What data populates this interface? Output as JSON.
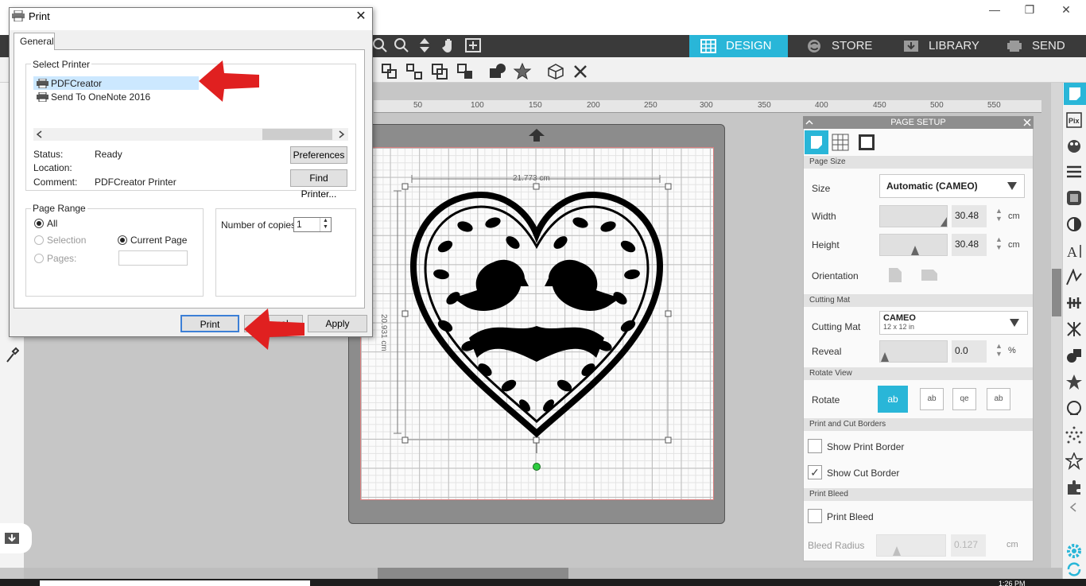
{
  "window": {
    "controls": {
      "minimize": "—",
      "maximize": "❐",
      "close": "✕"
    }
  },
  "nav_tabs": [
    {
      "label": "DESIGN",
      "icon": "grid-icon",
      "active": true
    },
    {
      "label": "STORE",
      "icon": "store-icon"
    },
    {
      "label": "LIBRARY",
      "icon": "library-icon"
    },
    {
      "label": "SEND",
      "icon": "send-icon"
    }
  ],
  "ruler": {
    "ticks": [
      "50",
      "100",
      "150",
      "200",
      "250",
      "300",
      "350",
      "400",
      "450",
      "500",
      "550"
    ]
  },
  "canvas": {
    "width_label": "21.773 cm",
    "height_label": "20.931 cm"
  },
  "page_setup": {
    "title": "PAGE SETUP",
    "sections": {
      "page_size": "Page Size",
      "cutting_mat": "Cutting Mat",
      "rotate_view": "Rotate View",
      "print_cut_borders": "Print and Cut Borders",
      "print_bleed": "Print Bleed"
    },
    "size_label": "Size",
    "size_value": "Automatic (CAMEO)",
    "width_label": "Width",
    "width_value": "30.48",
    "height_label": "Height",
    "height_value": "30.48",
    "unit": "cm",
    "orientation_label": "Orientation",
    "cutting_mat_label": "Cutting Mat",
    "mat_name": "CAMEO",
    "mat_size": "12 x 12 in",
    "reveal_label": "Reveal",
    "reveal_value": "0.0",
    "reveal_unit": "%",
    "rotate_label": "Rotate",
    "rotate_options": [
      "ab",
      "ab",
      "qe",
      "ab"
    ],
    "show_print_border": {
      "label": "Show Print Border",
      "checked": false
    },
    "show_cut_border": {
      "label": "Show Cut Border",
      "checked": true
    },
    "print_bleed": {
      "label": "Print Bleed",
      "checked": false
    },
    "bleed_radius_label": "Bleed Radius",
    "bleed_radius_value": "0.127",
    "bleed_unit": "cm"
  },
  "print_dialog": {
    "title": "Print",
    "tab": "General",
    "select_printer": "Select Printer",
    "printers": [
      {
        "name": "PDFCreator",
        "selected": true
      },
      {
        "name": "Send To OneNote 2016",
        "selected": false
      }
    ],
    "status_label": "Status:",
    "status_value": "Ready",
    "location_label": "Location:",
    "location_value": "",
    "comment_label": "Comment:",
    "comment_value": "PDFCreator Printer",
    "preferences_button": "Preferences",
    "find_printer_button": "Find Printer...",
    "page_range": "Page Range",
    "range_all": "All",
    "range_selection": "Selection",
    "range_current": "Current Page",
    "range_pages": "Pages:",
    "copies_label": "Number of copies:",
    "copies_value": "1",
    "print_button": "Print",
    "cancel_button": "Cancel",
    "apply_button": "Apply"
  },
  "taskbar": {
    "clock": "1:26 PM"
  },
  "colors": {
    "accent": "#29b6d8",
    "annotation_red": "#e02020"
  }
}
